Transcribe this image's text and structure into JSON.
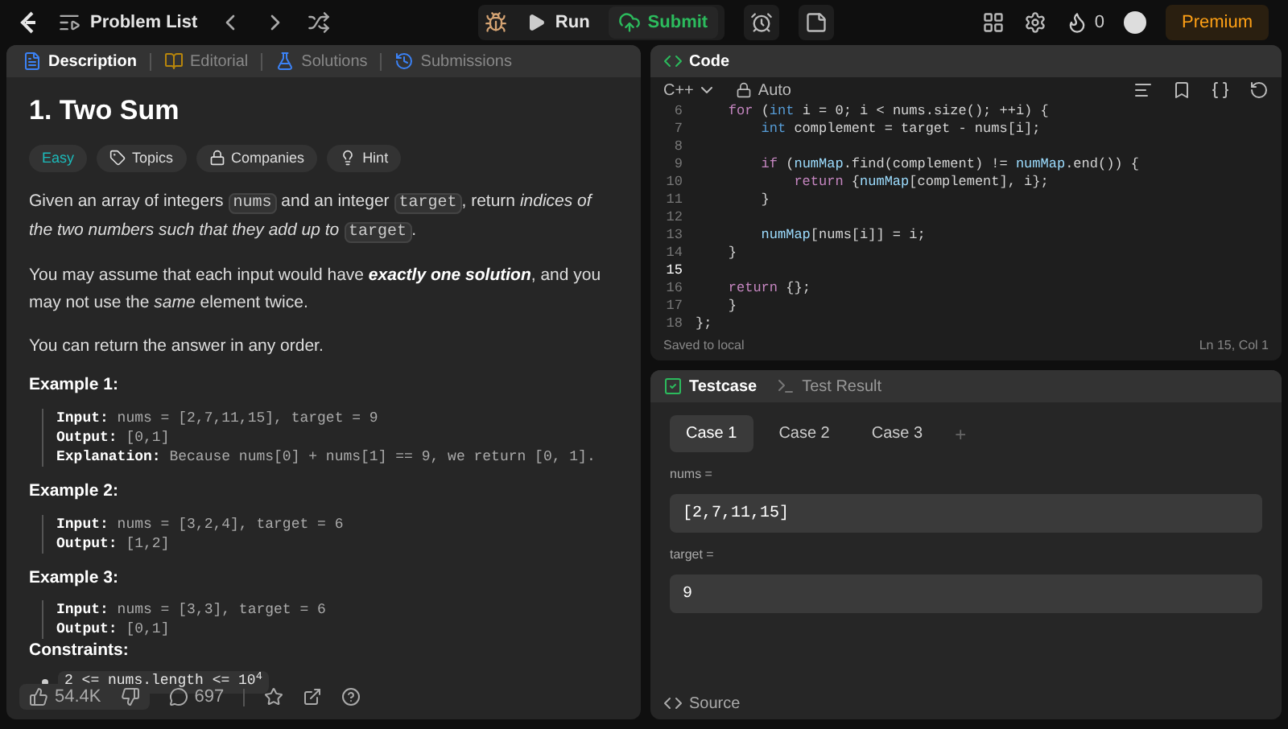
{
  "topbar": {
    "problem_list": "Problem List",
    "run": "Run",
    "submit": "Submit",
    "streak": "0",
    "premium": "Premium"
  },
  "left_tabs": [
    {
      "label": "Description",
      "selected": true
    },
    {
      "label": "Editorial",
      "selected": false
    },
    {
      "label": "Solutions",
      "selected": false
    },
    {
      "label": "Submissions",
      "selected": false
    }
  ],
  "problem": {
    "title": "1. Two Sum",
    "difficulty": "Easy",
    "tags": [
      "Topics",
      "Companies",
      "Hint"
    ],
    "paragraphs": [
      [
        {
          "kind": "text",
          "text": "Given an array of integers "
        },
        {
          "kind": "code",
          "text": "nums"
        },
        {
          "kind": "text",
          "text": " and an integer "
        },
        {
          "kind": "code",
          "text": "target"
        },
        {
          "kind": "text",
          "text": ", return "
        },
        {
          "kind": "italic",
          "text": "indices of the two numbers such that they add up to "
        },
        {
          "kind": "code",
          "text": "target"
        },
        {
          "kind": "text",
          "text": "."
        }
      ],
      [
        {
          "kind": "text",
          "text": "You may assume that each input would have "
        },
        {
          "kind": "bolditalic",
          "text": "exactly one solution"
        },
        {
          "kind": "text",
          "text": ", and you may not use the "
        },
        {
          "kind": "italic",
          "text": "same"
        },
        {
          "kind": "text",
          "text": " element twice."
        }
      ],
      [
        {
          "kind": "text",
          "text": "You can return the answer in any order."
        }
      ]
    ],
    "examples": [
      {
        "title": "Example 1:",
        "lines": [
          {
            "label": "Input:",
            "value": "nums = [2,7,11,15], target = 9"
          },
          {
            "label": "Output:",
            "value": "[0,1]"
          },
          {
            "label": "Explanation:",
            "value": "Because nums[0] + nums[1] == 9, we return [0, 1]."
          }
        ]
      },
      {
        "title": "Example 2:",
        "lines": [
          {
            "label": "Input:",
            "value": "nums = [3,2,4], target = 6"
          },
          {
            "label": "Output:",
            "value": "[1,2]"
          }
        ]
      },
      {
        "title": "Example 3:",
        "lines": [
          {
            "label": "Input:",
            "value": "nums = [3,3], target = 6"
          },
          {
            "label": "Output:",
            "value": "[0,1]"
          }
        ]
      }
    ],
    "constraints_title": "Constraints:",
    "constraints": [
      "2 <= nums.length <= 10$^{4}$"
    ]
  },
  "footer": {
    "likes": "54.4K",
    "comments": "697"
  },
  "code_panel": {
    "title": "Code",
    "language": "C++",
    "mode": "Auto",
    "status": "Saved to local",
    "cursor": "Ln 15, Col 1",
    "lines": [
      {
        "number": "6",
        "current": false,
        "tokens": [
          {
            "kind": "keyword",
            "text": "    for"
          },
          {
            "kind": "plain",
            "text": " ("
          },
          {
            "kind": "type",
            "text": "int"
          },
          {
            "kind": "plain",
            "text": " i = 0; i < nums.size(); ++i) {"
          }
        ]
      },
      {
        "number": "7",
        "current": false,
        "tokens": [
          {
            "kind": "type",
            "text": "        int"
          },
          {
            "kind": "plain",
            "text": " complement = target - nums[i];"
          }
        ]
      },
      {
        "number": "8",
        "current": false
      },
      {
        "number": "9",
        "current": false,
        "tokens": [
          {
            "kind": "keyword",
            "text": "        if"
          },
          {
            "kind": "plain",
            "text": " ("
          },
          {
            "kind": "var",
            "text": "numMap"
          },
          {
            "kind": "plain",
            "text": ".find(complement) != "
          },
          {
            "kind": "var",
            "text": "numMap"
          },
          {
            "kind": "plain",
            "text": ".end()) {"
          }
        ]
      },
      {
        "number": "10",
        "current": false,
        "tokens": [
          {
            "kind": "keyword",
            "text": "            return"
          },
          {
            "kind": "plain",
            "text": " {"
          },
          {
            "kind": "var",
            "text": "numMap"
          },
          {
            "kind": "plain",
            "text": "[complement], i};"
          }
        ]
      },
      {
        "number": "11",
        "current": false,
        "tokens": [
          {
            "kind": "plain",
            "text": "        }"
          }
        ]
      },
      {
        "number": "12",
        "current": false
      },
      {
        "number": "13",
        "current": false,
        "tokens": [
          {
            "kind": "var",
            "text": "        numMap"
          },
          {
            "kind": "plain",
            "text": "[nums[i]] = i;"
          }
        ]
      },
      {
        "number": "14",
        "current": false,
        "tokens": [
          {
            "kind": "plain",
            "text": "    }"
          }
        ]
      },
      {
        "number": "15",
        "current": true
      },
      {
        "number": "16",
        "current": false,
        "tokens": [
          {
            "kind": "keyword",
            "text": "    return"
          },
          {
            "kind": "plain",
            "text": " {};"
          }
        ]
      },
      {
        "number": "17",
        "current": false,
        "tokens": [
          {
            "kind": "plain",
            "text": "    }"
          }
        ]
      },
      {
        "number": "18",
        "current": false,
        "tokens": [
          {
            "kind": "plain",
            "text": "};"
          }
        ]
      }
    ]
  },
  "test_tabs": [
    {
      "label": "Testcase",
      "selected": true
    },
    {
      "label": "Test Result",
      "selected": false
    }
  ],
  "cases": [
    {
      "label": "Case 1",
      "selected": true
    },
    {
      "label": "Case 2",
      "selected": false
    },
    {
      "label": "Case 3",
      "selected": false
    }
  ],
  "add_case": "+",
  "inputs": [
    {
      "label": "nums =",
      "value": "[2,7,11,15]"
    },
    {
      "label": "target =",
      "value": "9"
    }
  ],
  "source": "Source"
}
